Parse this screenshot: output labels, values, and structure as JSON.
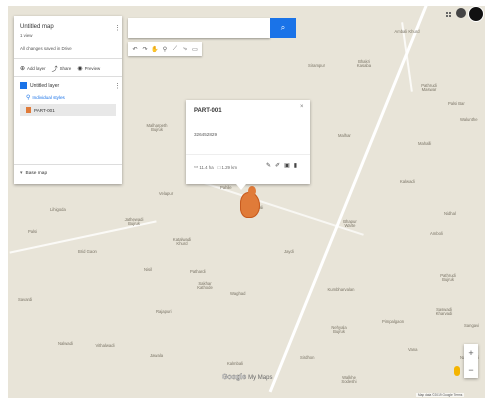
{
  "panel": {
    "title": "Untitled map",
    "subtitle": "1 view",
    "saved": "All changes saved in Drive",
    "actions": {
      "add_layer": "Add layer",
      "share": "Share",
      "preview": "Preview"
    },
    "layer_name": "Untitled layer",
    "layer_style": "Individual styles",
    "layer_item": "PART-001",
    "base_map": "Base map"
  },
  "popup": {
    "title": "PART-001",
    "value": "326452829",
    "area": "11.4 ha",
    "perimeter": "1.29 km"
  },
  "footer": {
    "logo_google": "Google",
    "logo_mymaps": "My Maps",
    "attribution": "Map data ©2019 Google  Terms"
  },
  "towns": [
    "Ambali Khurd",
    "Palsi Bar",
    "Sirampur",
    "Bhakri Kasaba",
    "Pathrudi Maswar",
    "Malharpeth Bujruk",
    "Walunthe",
    "Malhar",
    "Mahalli",
    "Kalwadi",
    "Nidhal",
    "Amboli",
    "Palsi",
    "Tenhali",
    "Lihigoda",
    "Jathewadi Bujruk",
    "Katalwadi Khurd",
    "Bhapur Warte",
    "Pahile",
    "Jaydi",
    "Velapur",
    "Brid Gaon",
    "Nisil",
    "Pathardi",
    "Pathrudi Bujruk",
    "Sakhar Kathode",
    "Waghad",
    "Rajapuri",
    "Savardi",
    "Kumbharvalan",
    "Saswadi Kharvadi",
    "Pimpalgaon",
    "Sangavi",
    "Nalwadi",
    "Vithalwadi",
    "Jawala",
    "Nehyala Bujruk",
    "Vana",
    "Nadewadi",
    "Kalmbali",
    "Walkhe Sodeshi",
    "Sirdhon"
  ]
}
